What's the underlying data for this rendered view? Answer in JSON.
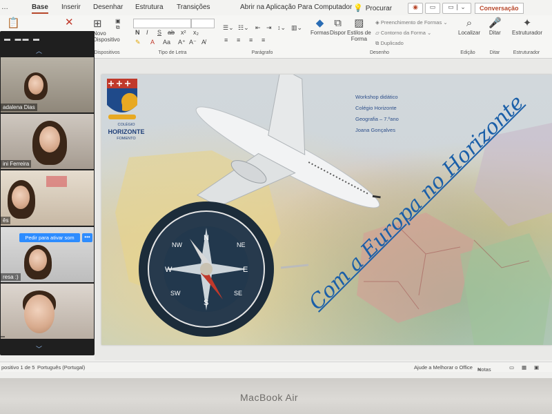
{
  "tabs": [
    "Base",
    "Inserir",
    "Desenhar",
    "Estrutura",
    "Transições"
  ],
  "active_tab": "Base",
  "open_in_app": "Abrir na Aplicação Para Computador",
  "search": {
    "label": "Procurar",
    "icon": "lightbulb-icon"
  },
  "conversation_button": "Conversação",
  "ribbon": {
    "new_slide": [
      "Novo",
      "Dispositivo"
    ],
    "groups": {
      "slides": "Dispositivos",
      "font": "Tipo de Letra",
      "paragraph": "Parágrafo",
      "drawing": "Desenho",
      "editing": "Edição",
      "dictate": "Ditar",
      "designer": "Estruturador"
    },
    "formas": "Formas",
    "dispor": "Dispor",
    "estilos": [
      "Estilos de",
      "Forma"
    ],
    "fill": "Preenchimento de Formas",
    "outline": "Contorno da Forma",
    "duplicate": "Duplicado",
    "localizar": "Localizar",
    "ditar": "Ditar",
    "estruturador": "Estruturador",
    "format_buttons": [
      "N",
      "I",
      "S",
      "ab",
      "x²",
      "x₂"
    ]
  },
  "participants": [
    {
      "name": "adalena Dias"
    },
    {
      "name": "ini Ferreira"
    },
    {
      "name": "ês"
    },
    {
      "name": "resa :)"
    },
    {
      "name": ""
    }
  ],
  "unmute_button": "Pedir para ativar som",
  "more_button": "•••",
  "slide": {
    "logo_line1": "COLÉGIO",
    "logo_line2": "HORIZONTE",
    "logo_line3": "FOMENTO",
    "info": [
      "Workshop didático",
      "Colégio Horizonte",
      "Geografia – 7.ºano",
      "Joana Gonçalves"
    ],
    "title": "Com a Europa no Horizonte",
    "compass_marks": [
      "N",
      "NE",
      "E",
      "SE",
      "S",
      "SW",
      "W",
      "NW"
    ]
  },
  "status": {
    "slide_info": "positivo 1 de 5",
    "language": "Português (Portugal)",
    "help": "Ajude a Melhorar o Office",
    "notes": "Notas"
  },
  "laptop_label": "MacBook Air",
  "colors": {
    "accent": "#b7472a",
    "zoom_blue": "#2d8cff",
    "title_blue": "#1b5fa8"
  }
}
